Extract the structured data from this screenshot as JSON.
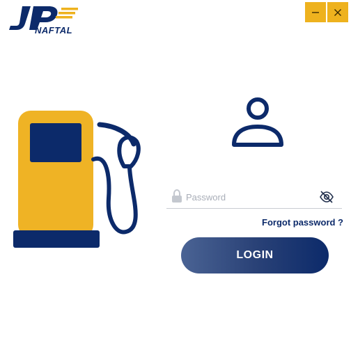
{
  "logo": {
    "text": "NAFTAL",
    "icon": "jp-logo-icon"
  },
  "window_controls": {
    "minimize_icon": "minimize-icon",
    "close_icon": "close-icon"
  },
  "illustration": {
    "icon": "fuel-pump-icon"
  },
  "user_icon": "user-icon",
  "password": {
    "placeholder": "Password",
    "value": "",
    "lock_icon": "lock-icon",
    "toggle_icon": "eye-slash-icon"
  },
  "forgot_password": "Forgot password ?",
  "login_label": "LOGIN",
  "colors": {
    "brand_navy": "#0c2a6a",
    "brand_yellow": "#eeb21e",
    "pump_yellow": "#efb325",
    "button_gradient_start": "#4a6394",
    "button_gradient_end": "#0c2a6a"
  }
}
